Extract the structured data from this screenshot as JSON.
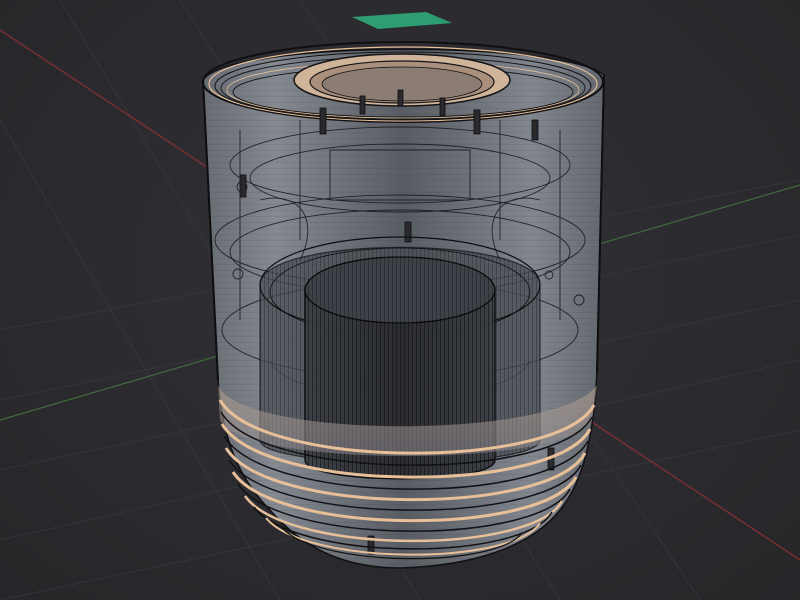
{
  "viewport": {
    "background_color": "#2b2b2f",
    "grid_line_color": "#3a3a3e",
    "x_axis_color": "#8a2f35",
    "y_axis_color": "#3f6b3a",
    "gizmo_plane_color": "#2e9d74"
  },
  "model": {
    "shell_color": "#8f949c",
    "wire_color": "#141416",
    "accent_ring_color": "#e7bf98",
    "base_ring_count": 12
  },
  "icons": [
    "camera-gizmo-plane-icon"
  ]
}
